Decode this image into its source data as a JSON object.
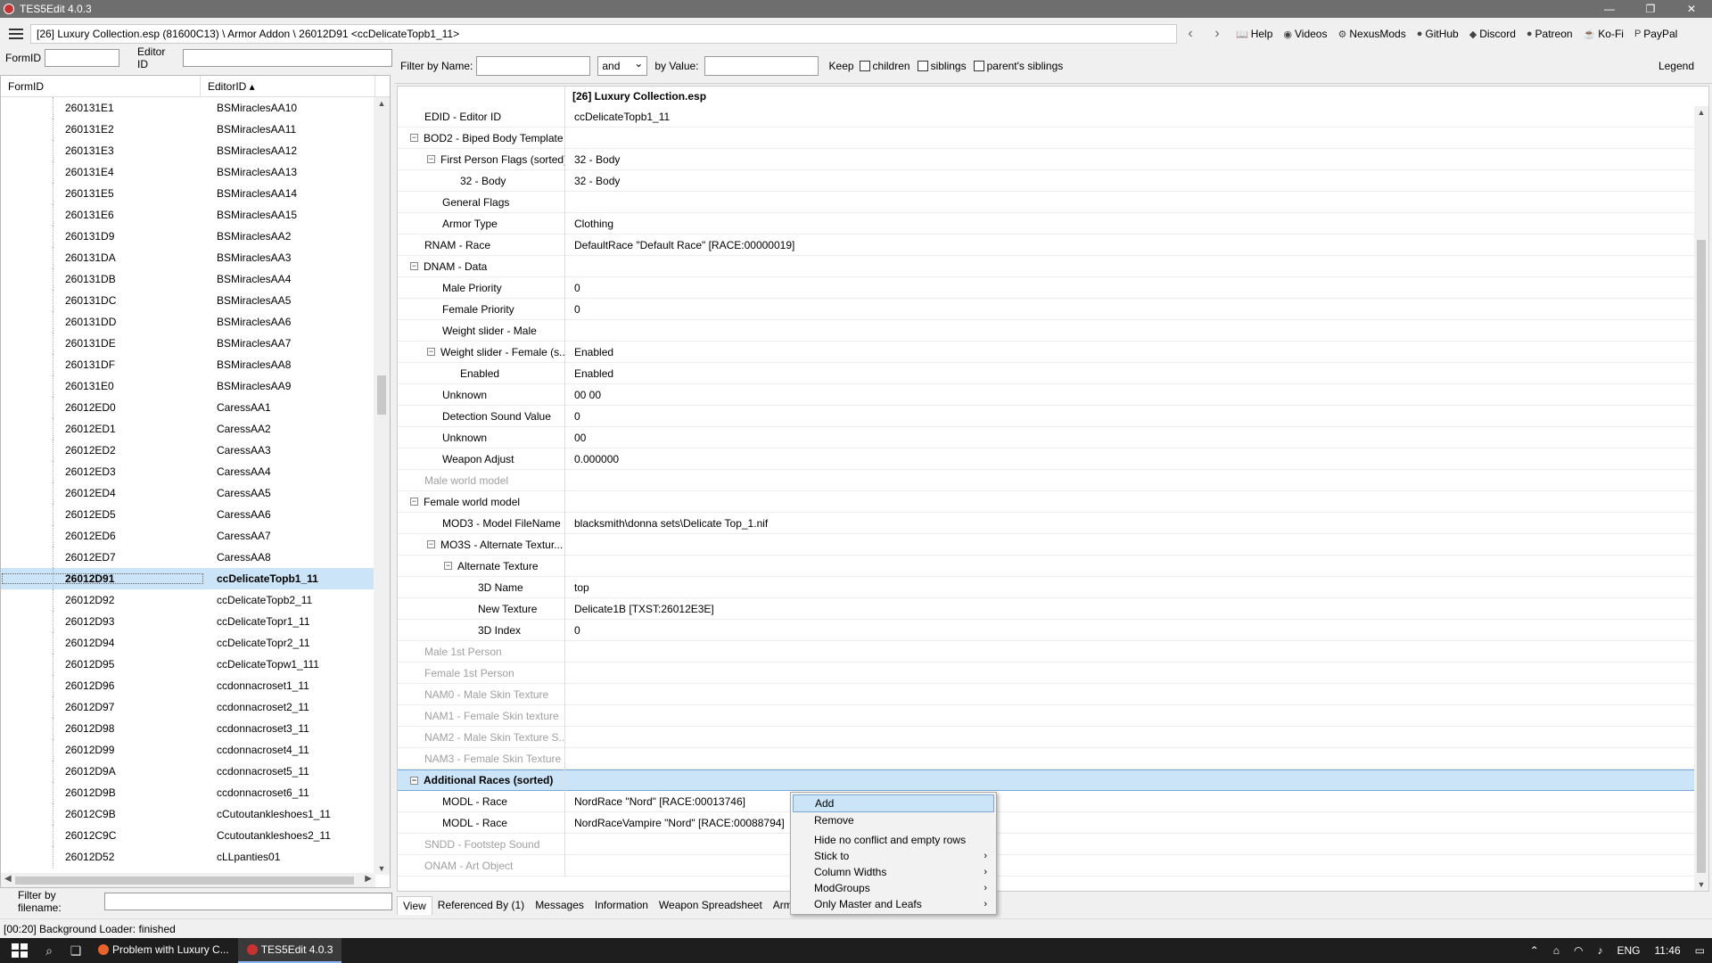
{
  "window": {
    "title": "TES5Edit 4.0.3",
    "min": "—",
    "max": "❐",
    "close": "✕"
  },
  "address": {
    "path": "[26] Luxury Collection.esp (81600C13) \\ Armor Addon \\ 26012D91 <ccDelicateTopb1_11>",
    "back": "‹",
    "forward": "›",
    "links": [
      {
        "icon": "book-icon",
        "glyph": "📖",
        "label": "Help"
      },
      {
        "icon": "videos-icon",
        "glyph": "◉",
        "label": "Videos"
      },
      {
        "icon": "nexusmods-icon",
        "glyph": "⚙",
        "label": "NexusMods"
      },
      {
        "icon": "github-icon",
        "glyph": "●",
        "label": "GitHub"
      },
      {
        "icon": "discord-icon",
        "glyph": "◆",
        "label": "Discord"
      },
      {
        "icon": "patreon-icon",
        "glyph": "●",
        "label": "Patreon"
      },
      {
        "icon": "kofi-icon",
        "glyph": "☕",
        "label": "Ko-Fi"
      },
      {
        "icon": "paypal-icon",
        "glyph": "P",
        "label": "PayPal"
      }
    ]
  },
  "left": {
    "formid_label": "FormID",
    "editorid_label": "Editor ID",
    "col_formid": "FormID",
    "col_editorid": "EditorID ▴",
    "rows": [
      {
        "fid": "260131E1",
        "eid": "BSMiraclesAA10"
      },
      {
        "fid": "260131E2",
        "eid": "BSMiraclesAA11"
      },
      {
        "fid": "260131E3",
        "eid": "BSMiraclesAA12"
      },
      {
        "fid": "260131E4",
        "eid": "BSMiraclesAA13"
      },
      {
        "fid": "260131E5",
        "eid": "BSMiraclesAA14"
      },
      {
        "fid": "260131E6",
        "eid": "BSMiraclesAA15"
      },
      {
        "fid": "260131D9",
        "eid": "BSMiraclesAA2"
      },
      {
        "fid": "260131DA",
        "eid": "BSMiraclesAA3"
      },
      {
        "fid": "260131DB",
        "eid": "BSMiraclesAA4"
      },
      {
        "fid": "260131DC",
        "eid": "BSMiraclesAA5"
      },
      {
        "fid": "260131DD",
        "eid": "BSMiraclesAA6"
      },
      {
        "fid": "260131DE",
        "eid": "BSMiraclesAA7"
      },
      {
        "fid": "260131DF",
        "eid": "BSMiraclesAA8"
      },
      {
        "fid": "260131E0",
        "eid": "BSMiraclesAA9"
      },
      {
        "fid": "26012ED0",
        "eid": "CaressAA1"
      },
      {
        "fid": "26012ED1",
        "eid": "CaressAA2"
      },
      {
        "fid": "26012ED2",
        "eid": "CaressAA3"
      },
      {
        "fid": "26012ED3",
        "eid": "CaressAA4"
      },
      {
        "fid": "26012ED4",
        "eid": "CaressAA5"
      },
      {
        "fid": "26012ED5",
        "eid": "CaressAA6"
      },
      {
        "fid": "26012ED6",
        "eid": "CaressAA7"
      },
      {
        "fid": "26012ED7",
        "eid": "CaressAA8"
      },
      {
        "fid": "26012D91",
        "eid": "ccDelicateTopb1_11"
      },
      {
        "fid": "26012D92",
        "eid": "ccDelicateTopb2_11"
      },
      {
        "fid": "26012D93",
        "eid": "ccDelicateTopr1_11"
      },
      {
        "fid": "26012D94",
        "eid": "ccDelicateTopr2_11"
      },
      {
        "fid": "26012D95",
        "eid": "ccDelicateTopw1_111"
      },
      {
        "fid": "26012D96",
        "eid": "ccdonnacroset1_11"
      },
      {
        "fid": "26012D97",
        "eid": "ccdonnacroset2_11"
      },
      {
        "fid": "26012D98",
        "eid": "ccdonnacroset3_11"
      },
      {
        "fid": "26012D99",
        "eid": "ccdonnacroset4_11"
      },
      {
        "fid": "26012D9A",
        "eid": "ccdonnacroset5_11"
      },
      {
        "fid": "26012D9B",
        "eid": "ccdonnacroset6_11"
      },
      {
        "fid": "26012C9B",
        "eid": "cCutoutankleshoes1_11"
      },
      {
        "fid": "26012C9C",
        "eid": "Ccutoutankleshoes2_11"
      },
      {
        "fid": "26012D52",
        "eid": "cLLpanties01"
      }
    ],
    "selected_index": 22,
    "filename_filter_label": "Filter by filename:"
  },
  "right": {
    "filter_name_label": "Filter by Name:",
    "and_label": "and",
    "filter_value_label": "by Value:",
    "keep_label": "Keep",
    "children_label": "children",
    "siblings_label": "siblings",
    "parents_siblings_label": "parent's siblings",
    "legend_label": "Legend",
    "file_header": "[26] Luxury Collection.esp",
    "rows": [
      {
        "n": "EDID - Editor ID",
        "v": "ccDelicateTopb1_11",
        "lvl": 0
      },
      {
        "n": "BOD2 - Biped Body Template",
        "v": "",
        "lvl": 0,
        "exp": true
      },
      {
        "n": "First Person Flags (sorted)",
        "v": "32 - Body",
        "lvl": 1,
        "exp": true
      },
      {
        "n": "32 - Body",
        "v": "32 - Body",
        "lvl": 2
      },
      {
        "n": "General Flags",
        "v": "",
        "lvl": 1
      },
      {
        "n": "Armor Type",
        "v": "Clothing",
        "lvl": 1
      },
      {
        "n": "RNAM - Race",
        "v": "DefaultRace \"Default Race\" [RACE:00000019]",
        "lvl": 0
      },
      {
        "n": "DNAM - Data",
        "v": "",
        "lvl": 0,
        "exp": true
      },
      {
        "n": "Male Priority",
        "v": "0",
        "lvl": 1
      },
      {
        "n": "Female Priority",
        "v": "0",
        "lvl": 1
      },
      {
        "n": "Weight slider - Male",
        "v": "",
        "lvl": 1
      },
      {
        "n": "Weight slider - Female (s...",
        "v": "Enabled",
        "lvl": 1,
        "exp": true
      },
      {
        "n": "Enabled",
        "v": "Enabled",
        "lvl": 2
      },
      {
        "n": "Unknown",
        "v": "00 00",
        "lvl": 1
      },
      {
        "n": "Detection Sound Value",
        "v": "0",
        "lvl": 1
      },
      {
        "n": "Unknown",
        "v": "00",
        "lvl": 1
      },
      {
        "n": "Weapon Adjust",
        "v": "0.000000",
        "lvl": 1
      },
      {
        "n": "Male world model",
        "v": "",
        "lvl": 0,
        "dim": true
      },
      {
        "n": "Female world model",
        "v": "",
        "lvl": 0,
        "exp": true
      },
      {
        "n": "MOD3 - Model FileName",
        "v": "blacksmith\\donna sets\\Delicate Top_1.nif",
        "lvl": 1
      },
      {
        "n": "MO3S - Alternate Textur...",
        "v": "",
        "lvl": 1,
        "exp": true
      },
      {
        "n": "Alternate Texture",
        "v": "",
        "lvl": 2,
        "exp": true
      },
      {
        "n": "3D Name",
        "v": "top",
        "lvl": 3
      },
      {
        "n": "New Texture",
        "v": "Delicate1B [TXST:26012E3E]",
        "lvl": 3
      },
      {
        "n": "3D Index",
        "v": "0",
        "lvl": 3
      },
      {
        "n": "Male 1st Person",
        "v": "",
        "lvl": 0,
        "dim": true
      },
      {
        "n": "Female 1st Person",
        "v": "",
        "lvl": 0,
        "dim": true
      },
      {
        "n": "NAM0 - Male Skin Texture",
        "v": "",
        "lvl": 0,
        "dim": true
      },
      {
        "n": "NAM1 - Female Skin texture",
        "v": "",
        "lvl": 0,
        "dim": true
      },
      {
        "n": "NAM2 - Male Skin Texture S...",
        "v": "",
        "lvl": 0,
        "dim": true
      },
      {
        "n": "NAM3 - Female Skin Texture ...",
        "v": "",
        "lvl": 0,
        "dim": true
      },
      {
        "n": "Additional Races (sorted)",
        "v": "",
        "lvl": 0,
        "exp": true,
        "bold": true,
        "hl": true
      },
      {
        "n": "MODL - Race",
        "v": "NordRace \"Nord\" [RACE:00013746]",
        "lvl": 1
      },
      {
        "n": "MODL - Race",
        "v": "NordRaceVampire \"Nord\" [RACE:00088794]",
        "lvl": 1
      },
      {
        "n": "SNDD - Footstep Sound",
        "v": "",
        "lvl": 0,
        "dim": true
      },
      {
        "n": "ONAM - Art Object",
        "v": "",
        "lvl": 0,
        "dim": true
      }
    ],
    "tabs": [
      "View",
      "Referenced By (1)",
      "Messages",
      "Information",
      "Weapon Spreadsheet",
      "Armor Spre",
      "w"
    ]
  },
  "context_menu": {
    "items": [
      {
        "label": "Add",
        "sub": false
      },
      {
        "label": "Remove",
        "sub": false
      },
      {
        "label": "Hide no conflict and empty rows",
        "sub": false
      },
      {
        "label": "Stick to",
        "sub": true
      },
      {
        "label": "Column Widths",
        "sub": true
      },
      {
        "label": "ModGroups",
        "sub": true
      },
      {
        "label": "Only Master and Leafs",
        "sub": true
      }
    ]
  },
  "status": {
    "text": "[00:20] Background Loader: finished"
  },
  "taskbar": {
    "apps": [
      {
        "label": "Problem with Luxury C...",
        "color": "#e8622c"
      },
      {
        "label": "TES5Edit 4.0.3",
        "color": "#c83232"
      }
    ],
    "lang": "ENG",
    "time": "11:46"
  }
}
